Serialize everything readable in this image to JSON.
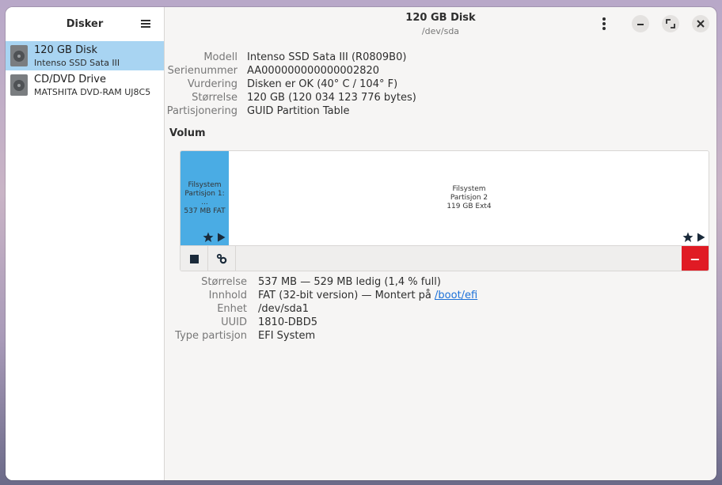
{
  "sidebar": {
    "title": "Disker",
    "disks": [
      {
        "name": "120 GB Disk",
        "sub": "Intenso SSD Sata III"
      },
      {
        "name": "CD/DVD Drive",
        "sub": "MATSHITA DVD-RAM UJ8C5"
      }
    ]
  },
  "header": {
    "title": "120 GB Disk",
    "subtitle": "/dev/sda"
  },
  "disk_props": {
    "model_label": "Modell",
    "model_value": "Intenso SSD Sata III (R0809B0)",
    "serial_label": "Serienummer",
    "serial_value": "AA000000000000002820",
    "assessment_label": "Vurdering",
    "assessment_value": "Disken er OK (40° C / 104° F)",
    "size_label": "Størrelse",
    "size_value": "120 GB (120 034 123 776 bytes)",
    "partitioning_label": "Partisjonering",
    "partitioning_value": "GUID Partition Table"
  },
  "volumes": {
    "title": "Volum",
    "partitions": [
      {
        "line1": "Filsystem",
        "line2": "Partisjon 1: ...",
        "line3": "537 MB FAT"
      },
      {
        "line1": "Filsystem",
        "line2": "Partisjon 2",
        "line3": "119 GB Ext4"
      }
    ],
    "delete_label": "−"
  },
  "partition_props": {
    "size_label": "Størrelse",
    "size_value": "537 MB — 529 MB ledig (1,4 % full)",
    "content_label": "Innhold",
    "content_value": "FAT (32-bit version) — Montert på ",
    "content_link": "/boot/efi",
    "device_label": "Enhet",
    "device_value": "/dev/sda1",
    "uuid_label": "UUID",
    "uuid_value": "1810-DBD5",
    "type_label": "Type partisjon",
    "type_value": "EFI System"
  },
  "colors": {
    "selected_bg": "#a8d4f2",
    "partition_fill": "#4aace4",
    "delete_bg": "#e01b24"
  },
  "icons": [
    "menu-icon",
    "disk-icon",
    "kebab-icon",
    "minimize-icon",
    "maximize-icon",
    "close-icon",
    "star-icon",
    "play-icon",
    "stop-icon",
    "gears-icon",
    "minus-icon"
  ]
}
